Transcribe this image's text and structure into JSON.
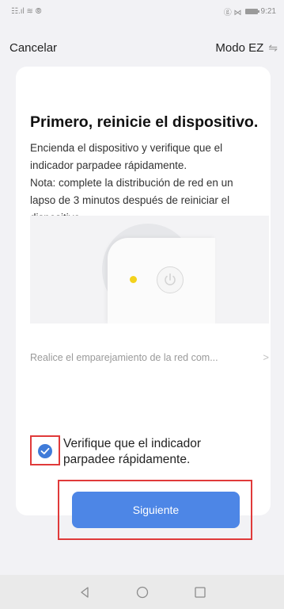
{
  "status_bar": {
    "left": "☷.ıl ≋ ⦾",
    "right_icons": "ⓖ ⋈",
    "time": "9:21"
  },
  "topbar": {
    "cancel_label": "Cancelar",
    "mode_label": "Modo EZ"
  },
  "main": {
    "title": "Primero, reinicie el dispositivo.",
    "description_lines": [
      "Encienda el dispositivo y verifique que el",
      "indicador parpadee rápidamente.",
      "Nota: complete la distribución de red en un",
      "lapso de 3 minutos después de reiniciar el",
      "dispositivo."
    ],
    "pairing_link": "Realice el emparejamiento de la red com...",
    "confirm_lines": [
      "Verifique que el indicador",
      "parpadee rápidamente."
    ],
    "confirm_checked": true,
    "next_button": "Siguiente"
  },
  "colors": {
    "accent": "#4d86e6",
    "highlight_frame": "#e03a3a",
    "led": "#f3d21c",
    "checkbox": "#3f7bd9"
  }
}
